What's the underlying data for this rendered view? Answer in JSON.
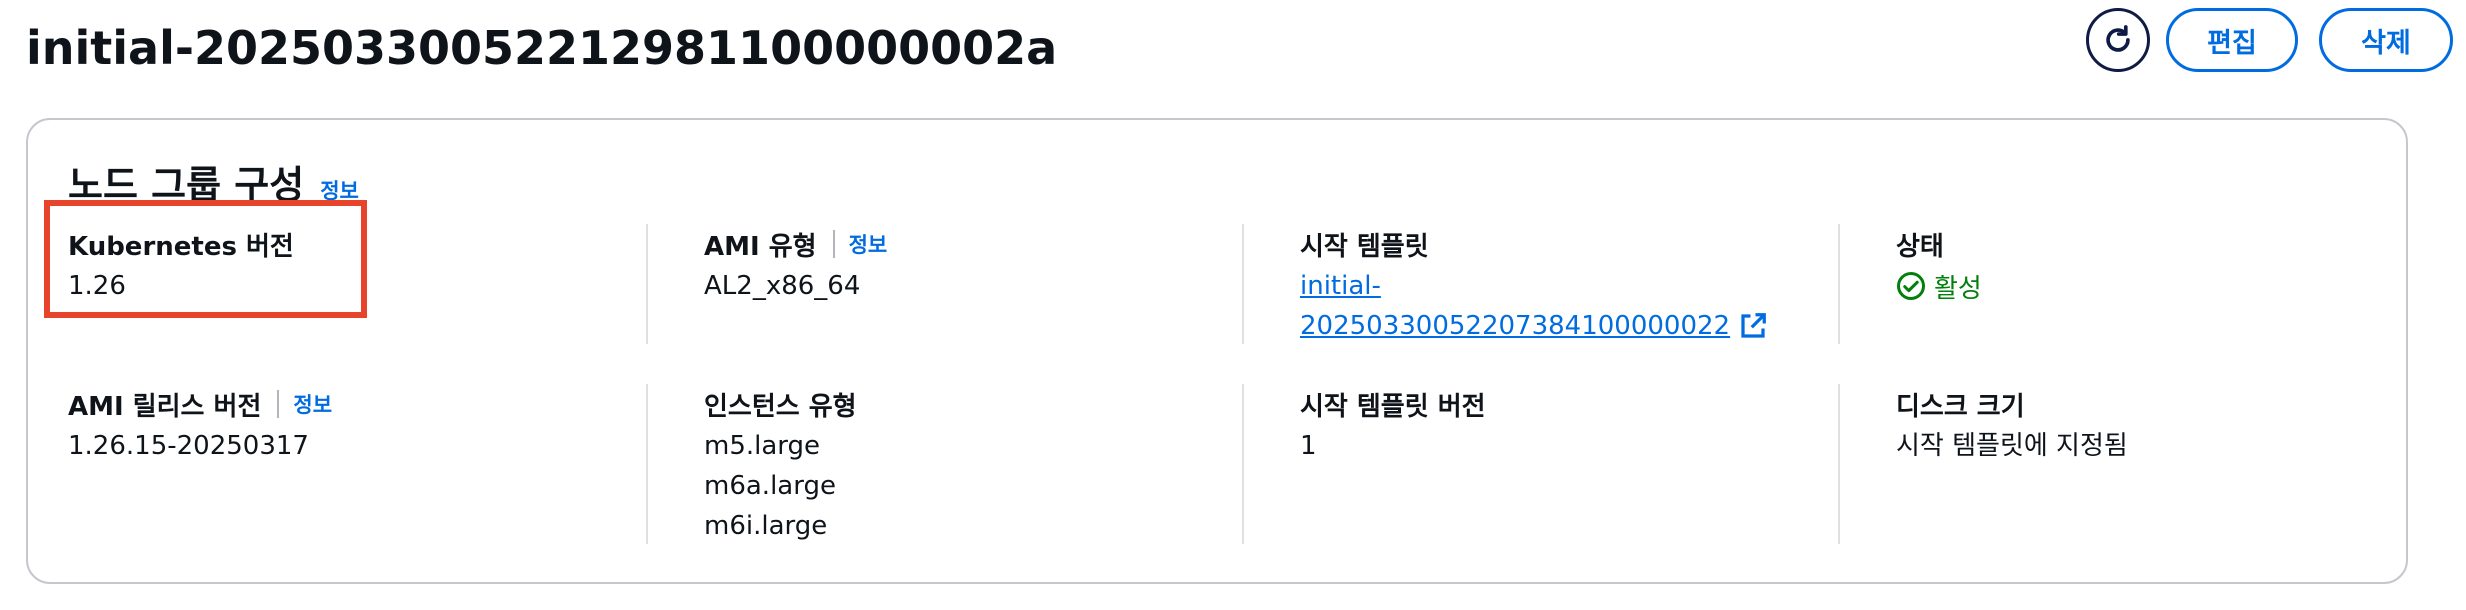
{
  "header": {
    "title": "initial-20250330052212981100000002a",
    "edit_label": "편집",
    "delete_label": "삭제",
    "refresh_icon": "refresh-icon"
  },
  "panel": {
    "title": "노드 그룹 구성",
    "info_label": "정보",
    "fields": {
      "kubernetes_version": {
        "label": "Kubernetes 버전",
        "value": "1.26"
      },
      "ami_type": {
        "label": "AMI 유형",
        "info": "정보",
        "value": "AL2_x86_64"
      },
      "launch_template": {
        "label": "시작 템플릿",
        "link_line1": "initial-",
        "link_line2": "20250330052207384100000022"
      },
      "status": {
        "label": "상태",
        "value": "활성",
        "color": "#037f0c"
      },
      "ami_release_version": {
        "label": "AMI 릴리스 버전",
        "info": "정보",
        "value": "1.26.15-20250317"
      },
      "instance_types": {
        "label": "인스턴스 유형",
        "values": [
          "m5.large",
          "m6a.large",
          "m6i.large"
        ]
      },
      "launch_template_version": {
        "label": "시작 템플릿 버전",
        "value": "1"
      },
      "disk_size": {
        "label": "디스크 크기",
        "value": "시작 템플릿에 지정됨"
      }
    }
  },
  "colors": {
    "accent": "#006ce0",
    "highlight": "#e8432b",
    "success": "#037f0c"
  }
}
